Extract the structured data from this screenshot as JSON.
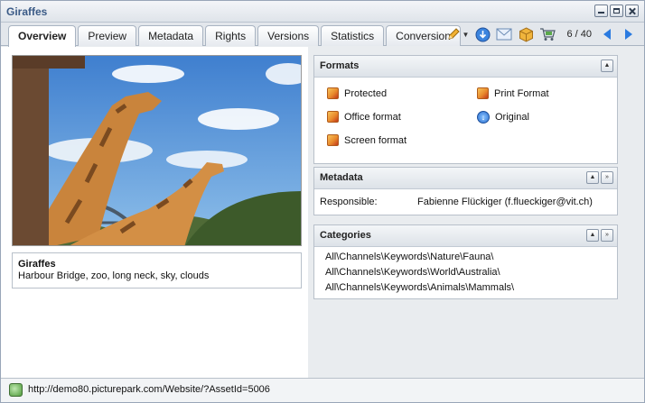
{
  "window": {
    "title": "Giraffes"
  },
  "tabs": [
    {
      "label": "Overview",
      "active": true
    },
    {
      "label": "Preview"
    },
    {
      "label": "Metadata"
    },
    {
      "label": "Rights"
    },
    {
      "label": "Versions"
    },
    {
      "label": "Statistics"
    },
    {
      "label": "Conversion"
    }
  ],
  "toolbar": {
    "icons": [
      "pencil-icon",
      "download-icon",
      "mail-icon",
      "package-icon",
      "cart-icon",
      "prev-arrow-icon",
      "next-arrow-icon"
    ],
    "pager": "6 / 40"
  },
  "asset": {
    "title": "Giraffes",
    "keywords": "Harbour Bridge, zoo, long neck, sky, clouds"
  },
  "formats": {
    "header": "Formats",
    "items": [
      {
        "label": "Protected",
        "icon": "format-icon"
      },
      {
        "label": "Print Format",
        "icon": "format-icon"
      },
      {
        "label": "Office format",
        "icon": "format-icon"
      },
      {
        "label": "Original",
        "icon": "original-icon"
      },
      {
        "label": "Screen format",
        "icon": "format-icon"
      }
    ]
  },
  "metadata": {
    "header": "Metadata",
    "responsible_label": "Responsible:",
    "responsible_value": "Fabienne Flückiger (f.flueckiger@vit.ch)"
  },
  "categories": {
    "header": "Categories",
    "items": [
      "All\\Channels\\Keywords\\Nature\\Fauna\\",
      "All\\Channels\\Keywords\\World\\Australia\\",
      "All\\Channels\\Keywords\\Animals\\Mammals\\"
    ]
  },
  "status": {
    "url": "http://demo80.picturepark.com/Website/?AssetId=5006"
  },
  "colors": {
    "title": "#3a5a86",
    "accent": "#2a6fd1"
  }
}
